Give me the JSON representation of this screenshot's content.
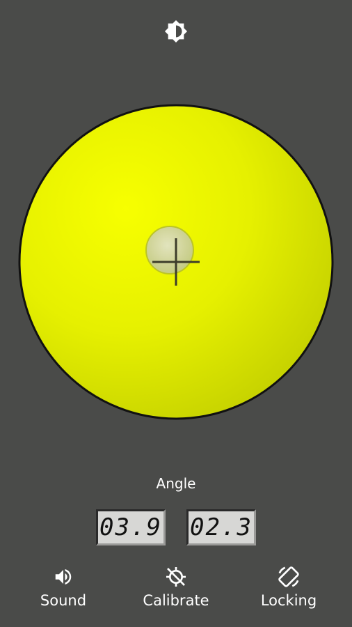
{
  "toolbar": {
    "brightness_icon": "brightness-icon"
  },
  "level": {
    "colors": {
      "surface_highlight": "#f7ff00",
      "surface_mid": "#e6f000",
      "surface_edge": "#c8d400",
      "rim": "#111111",
      "bubble": "#d8dca0"
    }
  },
  "angle": {
    "label": "Angle",
    "x_value": "03.9",
    "y_value": "02.3"
  },
  "actions": {
    "sound": {
      "label": "Sound",
      "icon": "speaker-icon"
    },
    "calibrate": {
      "label": "Calibrate",
      "icon": "calibrate-icon"
    },
    "locking": {
      "label": "Locking",
      "icon": "rotation-lock-icon"
    }
  }
}
